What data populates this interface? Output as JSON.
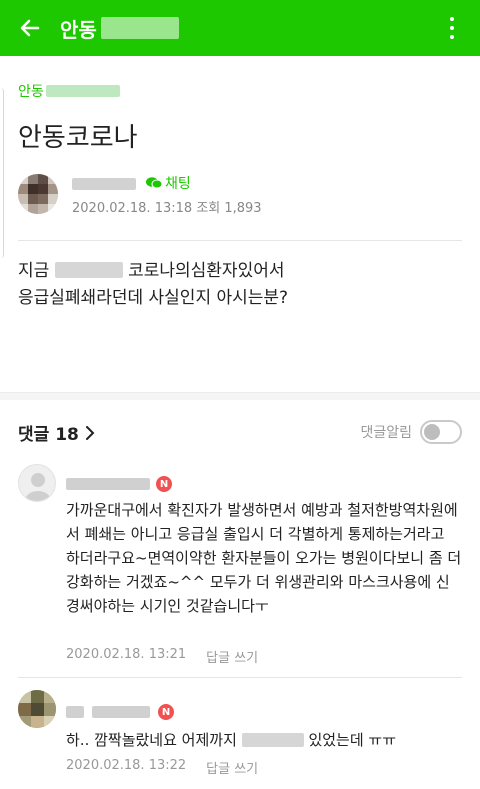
{
  "appbar": {
    "title": "안동"
  },
  "post": {
    "cafe_name": "안동",
    "title": "안동코로나",
    "chat_label": "채팅",
    "date": "2020.02.18. 13:18",
    "views_label": "조회 1,893",
    "body_line1_a": "지금",
    "body_line1_b": "코로나의심환자있어서",
    "body_line2": "응급실폐쇄라던데 사실인지 아시는분?"
  },
  "comments_header": {
    "count_label": "댓글 18",
    "notify_label": "댓글알림"
  },
  "comments": [
    {
      "badge": "N",
      "text": "가까운대구에서 확진자가 발생하면서 예방과 철저한방역차원에서 폐쇄는 아니고 응급실 출입시 더 각별하게 통제하는거라고 하더라구요~면역이약한 환자분들이 오가는 병원이다보니 좀 더 강화하는 거겠죠~^^ 모두가 더 위생관리와 마스크사용에 신경써야하는 시기인 것같습니다ㅜ",
      "date": "2020.02.18. 13:21",
      "reply_label": "답글 쓰기"
    },
    {
      "badge": "N",
      "text_a": "하.. 깜짝놀랐네요 어제까지",
      "text_b": "있었는데 ㅠㅠ",
      "date": "2020.02.18. 13:22",
      "reply_label": "답글 쓰기"
    }
  ],
  "colors": {
    "brand_green": "#1ec800",
    "badge_red": "#f25151"
  },
  "icons": [
    "back-arrow-icon",
    "more-vertical-icon",
    "chat-bubble-icon",
    "chevron-right-icon",
    "default-profile-icon"
  ]
}
